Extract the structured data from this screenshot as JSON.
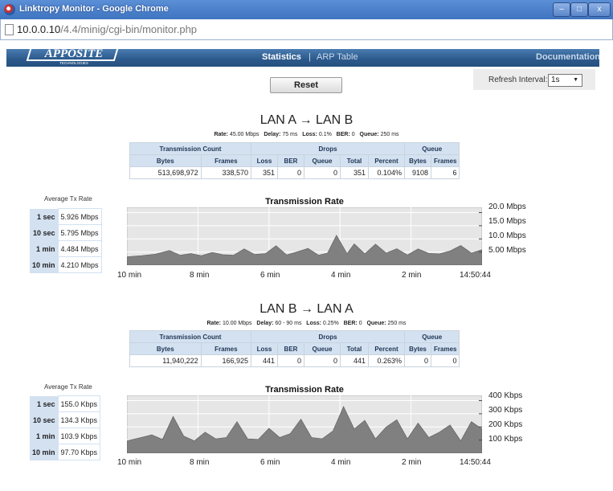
{
  "window": {
    "title": "Linktropy Monitor - Google Chrome"
  },
  "address": {
    "host": "10.0.0.10",
    "path": "/4.4/minig/cgi-bin/monitor.php"
  },
  "nav": {
    "logo": "APPOSITE",
    "logo_sub": "TECHNOLOGIES",
    "statistics": "Statistics",
    "separator": "|",
    "arp_table": "ARP Table",
    "documentation": "Documentation"
  },
  "controls": {
    "reset_label": "Reset",
    "refresh_label": "Refresh Interval:",
    "refresh_value": "1s"
  },
  "icons": {
    "app": "chrome-icon",
    "page": "page-icon",
    "dropdown": "chevron-down-icon"
  },
  "colors": {
    "nav_bg": "#2d5b8d",
    "header_cell": "#d3e1f1",
    "chart_fill": "#808080",
    "chart_bg": "#e6e6e6"
  },
  "table_headers": {
    "group": [
      "Transmission Count",
      "Drops",
      "Queue"
    ],
    "columns": [
      "Bytes",
      "Frames",
      "Loss",
      "BER",
      "Queue",
      "Total",
      "Percent",
      "Bytes",
      "Frames"
    ]
  },
  "sections": [
    {
      "title": "LAN A → LAN B",
      "params": {
        "rate_label": "Rate:",
        "rate": "45.00 Mbps",
        "delay_label": "Delay:",
        "delay": "75 ms",
        "loss_label": "Loss:",
        "loss": "0.1%",
        "ber_label": "BER:",
        "ber": "0",
        "queue_label": "Queue:",
        "queue": "250 ms"
      },
      "row": [
        "513,698,972",
        "338,570",
        "351",
        "0",
        "0",
        "351",
        "0.104%",
        "9108",
        "6"
      ],
      "avg_title": "Average Tx Rate",
      "avg": [
        {
          "period": "1 sec",
          "value": "5.926 Mbps"
        },
        {
          "period": "10 sec",
          "value": "5.795 Mbps"
        },
        {
          "period": "1 min",
          "value": "4.484 Mbps"
        },
        {
          "period": "10 min",
          "value": "4.210 Mbps"
        }
      ],
      "chart_data": {
        "type": "area",
        "title": "Transmission Rate",
        "xlabel": "",
        "ylabel": "",
        "x_ticks": [
          "10 min",
          "8 min",
          "6 min",
          "4 min",
          "2 min",
          "14:50:44"
        ],
        "y_ticks": [
          "20.0 Mbps",
          "15.0 Mbps",
          "10.0 Mbps",
          "5.00 Mbps"
        ],
        "y_unit": "Mbps",
        "ylim": [
          0,
          22
        ],
        "xlim": [
          -10,
          0
        ],
        "grid": true,
        "x_minutes_ago": [
          -10,
          -9.6,
          -9.2,
          -8.8,
          -8.5,
          -8.2,
          -7.9,
          -7.6,
          -7.3,
          -7.0,
          -6.7,
          -6.4,
          -6.1,
          -5.8,
          -5.5,
          -5.2,
          -4.9,
          -4.6,
          -4.35,
          -4.1,
          -3.8,
          -3.6,
          -3.3,
          -3.0,
          -2.7,
          -2.4,
          -2.1,
          -1.8,
          -1.5,
          -1.2,
          -0.9,
          -0.6,
          -0.3,
          0
        ],
        "values": [
          3.2,
          3.6,
          4.2,
          5.6,
          3.8,
          4.4,
          3.6,
          4.9,
          4.0,
          3.8,
          6.2,
          4.1,
          4.4,
          7.4,
          3.9,
          5.1,
          6.4,
          3.8,
          4.6,
          11.4,
          4.4,
          8.1,
          4.3,
          8.0,
          4.6,
          6.3,
          3.9,
          6.2,
          4.5,
          4.3,
          5.4,
          7.5,
          4.6,
          5.9
        ]
      }
    },
    {
      "title": "LAN B → LAN A",
      "params": {
        "rate_label": "Rate:",
        "rate": "10.00 Mbps",
        "delay_label": "Delay:",
        "delay": "60 - 90 ms",
        "loss_label": "Loss:",
        "loss": "0.25%",
        "ber_label": "BER:",
        "ber": "0",
        "queue_label": "Queue:",
        "queue": "250 ms"
      },
      "row": [
        "11,940,222",
        "166,925",
        "441",
        "0",
        "0",
        "441",
        "0.263%",
        "0",
        "0"
      ],
      "avg_title": "Average Tx Rate",
      "avg": [
        {
          "period": "1 sec",
          "value": "155.0 Kbps"
        },
        {
          "period": "10 sec",
          "value": "134.3 Kbps"
        },
        {
          "period": "1 min",
          "value": "103.9 Kbps"
        },
        {
          "period": "10 min",
          "value": "97.70 Kbps"
        }
      ],
      "chart_data": {
        "type": "area",
        "title": "Transmission Rate",
        "xlabel": "",
        "ylabel": "",
        "x_ticks": [
          "10 min",
          "8 min",
          "6 min",
          "4 min",
          "2 min",
          "14:50:44"
        ],
        "y_ticks": [
          "400 Kbps",
          "300 Kbps",
          "200 Kbps",
          "100 Kbps"
        ],
        "y_unit": "Kbps",
        "ylim": [
          0,
          440
        ],
        "xlim": [
          -10,
          0
        ],
        "grid": true,
        "x_minutes_ago": [
          -10,
          -9.6,
          -9.3,
          -9.0,
          -8.7,
          -8.4,
          -8.1,
          -7.8,
          -7.5,
          -7.2,
          -6.9,
          -6.6,
          -6.3,
          -6.0,
          -5.7,
          -5.4,
          -5.1,
          -4.8,
          -4.5,
          -4.2,
          -3.9,
          -3.6,
          -3.3,
          -3.0,
          -2.7,
          -2.4,
          -2.1,
          -1.8,
          -1.5,
          -1.2,
          -0.9,
          -0.6,
          -0.3,
          0
        ],
        "values": [
          95,
          120,
          140,
          105,
          280,
          130,
          95,
          160,
          110,
          120,
          240,
          110,
          105,
          190,
          120,
          150,
          260,
          120,
          110,
          170,
          355,
          185,
          250,
          110,
          200,
          255,
          110,
          230,
          120,
          160,
          215,
          95,
          240,
          185
        ]
      }
    }
  ]
}
